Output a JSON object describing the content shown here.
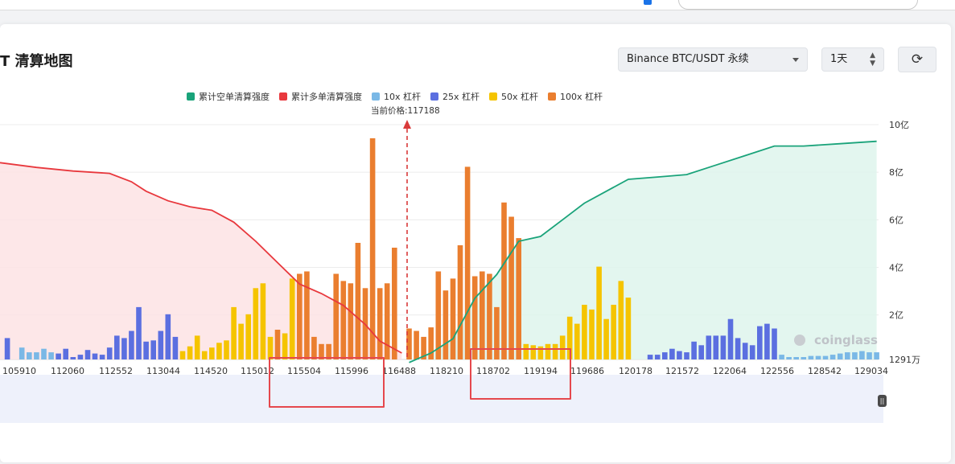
{
  "page": {
    "title": "T 清算地图",
    "exchange_select": "Binance BTC/USDT 永续",
    "period_select": "1天",
    "icons": [
      "refresh-icon",
      "chevron-down-icon",
      "updown-icon"
    ]
  },
  "chart_data": {
    "type": "bar",
    "legend_position": "top",
    "legend": [
      {
        "name": "累计空单清算强度",
        "color": "#1aa37a"
      },
      {
        "name": "累计多单清算强度",
        "color": "#e8383d"
      },
      {
        "name": "10x 杠杆",
        "color": "#7ab8e6"
      },
      {
        "name": "25x 杠杆",
        "color": "#5b6fe0"
      },
      {
        "name": "50x 杠杆",
        "color": "#f5c400"
      },
      {
        "name": "100x 杠杆",
        "color": "#ea7e2f"
      }
    ],
    "current_price_label": "当前价格:117188",
    "current_price": 117188,
    "y_ticks": [
      "10亿",
      "8亿",
      "6亿",
      "4亿",
      "2亿",
      "1291万"
    ],
    "ylim": [
      0.1291,
      10
    ],
    "y_tick_values": [
      10,
      8,
      6,
      4,
      2,
      0.1291
    ],
    "x_ticks": [
      "105910",
      "112060",
      "112552",
      "113044",
      "114520",
      "115012",
      "115504",
      "115996",
      "116488",
      "118210",
      "118702",
      "119194",
      "119686",
      "120178",
      "121572",
      "122064",
      "122556",
      "128542",
      "129034"
    ],
    "bars": [
      {
        "x": 1,
        "h": 0.9,
        "c": "#5b6fe0"
      },
      {
        "x": 3,
        "h": 0.5,
        "c": "#7ab8e6"
      },
      {
        "x": 4,
        "h": 0.3,
        "c": "#7ab8e6"
      },
      {
        "x": 5,
        "h": 0.3,
        "c": "#7ab8e6"
      },
      {
        "x": 6,
        "h": 0.45,
        "c": "#7ab8e6"
      },
      {
        "x": 7,
        "h": 0.3,
        "c": "#7ab8e6"
      },
      {
        "x": 8,
        "h": 0.25,
        "c": "#5b6fe0"
      },
      {
        "x": 9,
        "h": 0.45,
        "c": "#5b6fe0"
      },
      {
        "x": 10,
        "h": 0.1,
        "c": "#5b6fe0"
      },
      {
        "x": 11,
        "h": 0.2,
        "c": "#5b6fe0"
      },
      {
        "x": 12,
        "h": 0.4,
        "c": "#5b6fe0"
      },
      {
        "x": 13,
        "h": 0.25,
        "c": "#5b6fe0"
      },
      {
        "x": 14,
        "h": 0.2,
        "c": "#5b6fe0"
      },
      {
        "x": 15,
        "h": 0.5,
        "c": "#5b6fe0"
      },
      {
        "x": 16,
        "h": 1.0,
        "c": "#5b6fe0"
      },
      {
        "x": 17,
        "h": 0.9,
        "c": "#5b6fe0"
      },
      {
        "x": 18,
        "h": 1.2,
        "c": "#5b6fe0"
      },
      {
        "x": 19,
        "h": 2.2,
        "c": "#5b6fe0"
      },
      {
        "x": 20,
        "h": 0.75,
        "c": "#5b6fe0"
      },
      {
        "x": 21,
        "h": 0.8,
        "c": "#5b6fe0"
      },
      {
        "x": 22,
        "h": 1.2,
        "c": "#5b6fe0"
      },
      {
        "x": 23,
        "h": 1.9,
        "c": "#5b6fe0"
      },
      {
        "x": 24,
        "h": 0.95,
        "c": "#5b6fe0"
      },
      {
        "x": 25,
        "h": 0.35,
        "c": "#f5c400"
      },
      {
        "x": 26,
        "h": 0.55,
        "c": "#f5c400"
      },
      {
        "x": 27,
        "h": 1.0,
        "c": "#f5c400"
      },
      {
        "x": 28,
        "h": 0.35,
        "c": "#f5c400"
      },
      {
        "x": 29,
        "h": 0.5,
        "c": "#f5c400"
      },
      {
        "x": 30,
        "h": 0.7,
        "c": "#f5c400"
      },
      {
        "x": 31,
        "h": 0.8,
        "c": "#f5c400"
      },
      {
        "x": 32,
        "h": 2.2,
        "c": "#f5c400"
      },
      {
        "x": 33,
        "h": 1.5,
        "c": "#f5c400"
      },
      {
        "x": 34,
        "h": 1.9,
        "c": "#f5c400"
      },
      {
        "x": 35,
        "h": 3.0,
        "c": "#f5c400"
      },
      {
        "x": 36,
        "h": 3.2,
        "c": "#f5c400"
      },
      {
        "x": 37,
        "h": 0.95,
        "c": "#f5c400"
      },
      {
        "x": 38,
        "h": 1.25,
        "c": "#ea7e2f"
      },
      {
        "x": 39,
        "h": 1.1,
        "c": "#f5c400"
      },
      {
        "x": 40,
        "h": 3.4,
        "c": "#f5c400"
      },
      {
        "x": 41,
        "h": 3.6,
        "c": "#ea7e2f"
      },
      {
        "x": 42,
        "h": 3.7,
        "c": "#ea7e2f"
      },
      {
        "x": 43,
        "h": 0.95,
        "c": "#ea7e2f"
      },
      {
        "x": 44,
        "h": 0.65,
        "c": "#ea7e2f"
      },
      {
        "x": 45,
        "h": 0.65,
        "c": "#ea7e2f"
      },
      {
        "x": 46,
        "h": 3.6,
        "c": "#ea7e2f"
      },
      {
        "x": 47,
        "h": 3.3,
        "c": "#ea7e2f"
      },
      {
        "x": 48,
        "h": 3.2,
        "c": "#ea7e2f"
      },
      {
        "x": 49,
        "h": 4.9,
        "c": "#ea7e2f"
      },
      {
        "x": 50,
        "h": 3.0,
        "c": "#ea7e2f"
      },
      {
        "x": 51,
        "h": 9.3,
        "c": "#ea7e2f"
      },
      {
        "x": 52,
        "h": 3.0,
        "c": "#ea7e2f"
      },
      {
        "x": 53,
        "h": 3.2,
        "c": "#ea7e2f"
      },
      {
        "x": 54,
        "h": 4.7,
        "c": "#ea7e2f"
      },
      {
        "x": 56,
        "h": 1.3,
        "c": "#ea7e2f"
      },
      {
        "x": 57,
        "h": 1.2,
        "c": "#ea7e2f"
      },
      {
        "x": 58,
        "h": 0.95,
        "c": "#ea7e2f"
      },
      {
        "x": 59,
        "h": 1.35,
        "c": "#ea7e2f"
      },
      {
        "x": 60,
        "h": 3.7,
        "c": "#ea7e2f"
      },
      {
        "x": 61,
        "h": 2.9,
        "c": "#ea7e2f"
      },
      {
        "x": 62,
        "h": 3.4,
        "c": "#ea7e2f"
      },
      {
        "x": 63,
        "h": 4.8,
        "c": "#ea7e2f"
      },
      {
        "x": 64,
        "h": 8.1,
        "c": "#ea7e2f"
      },
      {
        "x": 65,
        "h": 3.5,
        "c": "#ea7e2f"
      },
      {
        "x": 66,
        "h": 3.7,
        "c": "#ea7e2f"
      },
      {
        "x": 67,
        "h": 3.6,
        "c": "#ea7e2f"
      },
      {
        "x": 68,
        "h": 2.2,
        "c": "#ea7e2f"
      },
      {
        "x": 69,
        "h": 6.6,
        "c": "#ea7e2f"
      },
      {
        "x": 70,
        "h": 6.0,
        "c": "#ea7e2f"
      },
      {
        "x": 71,
        "h": 5.1,
        "c": "#ea7e2f"
      },
      {
        "x": 72,
        "h": 0.65,
        "c": "#f5c400"
      },
      {
        "x": 73,
        "h": 0.6,
        "c": "#f5c400"
      },
      {
        "x": 74,
        "h": 0.55,
        "c": "#f5c400"
      },
      {
        "x": 75,
        "h": 0.65,
        "c": "#f5c400"
      },
      {
        "x": 76,
        "h": 0.65,
        "c": "#f5c400"
      },
      {
        "x": 77,
        "h": 1.0,
        "c": "#f5c400"
      },
      {
        "x": 78,
        "h": 1.8,
        "c": "#f5c400"
      },
      {
        "x": 79,
        "h": 1.5,
        "c": "#f5c400"
      },
      {
        "x": 80,
        "h": 2.3,
        "c": "#f5c400"
      },
      {
        "x": 81,
        "h": 2.1,
        "c": "#f5c400"
      },
      {
        "x": 82,
        "h": 3.9,
        "c": "#f5c400"
      },
      {
        "x": 83,
        "h": 1.7,
        "c": "#f5c400"
      },
      {
        "x": 84,
        "h": 2.3,
        "c": "#f5c400"
      },
      {
        "x": 85,
        "h": 3.3,
        "c": "#f5c400"
      },
      {
        "x": 86,
        "h": 2.6,
        "c": "#f5c400"
      },
      {
        "x": 89,
        "h": 0.2,
        "c": "#5b6fe0"
      },
      {
        "x": 90,
        "h": 0.2,
        "c": "#5b6fe0"
      },
      {
        "x": 91,
        "h": 0.3,
        "c": "#5b6fe0"
      },
      {
        "x": 92,
        "h": 0.45,
        "c": "#5b6fe0"
      },
      {
        "x": 93,
        "h": 0.35,
        "c": "#5b6fe0"
      },
      {
        "x": 94,
        "h": 0.3,
        "c": "#5b6fe0"
      },
      {
        "x": 95,
        "h": 0.75,
        "c": "#5b6fe0"
      },
      {
        "x": 96,
        "h": 0.6,
        "c": "#5b6fe0"
      },
      {
        "x": 97,
        "h": 1.0,
        "c": "#5b6fe0"
      },
      {
        "x": 98,
        "h": 1.0,
        "c": "#5b6fe0"
      },
      {
        "x": 99,
        "h": 1.0,
        "c": "#5b6fe0"
      },
      {
        "x": 100,
        "h": 1.7,
        "c": "#5b6fe0"
      },
      {
        "x": 101,
        "h": 0.9,
        "c": "#5b6fe0"
      },
      {
        "x": 102,
        "h": 0.7,
        "c": "#5b6fe0"
      },
      {
        "x": 103,
        "h": 0.6,
        "c": "#5b6fe0"
      },
      {
        "x": 104,
        "h": 1.4,
        "c": "#5b6fe0"
      },
      {
        "x": 105,
        "h": 1.5,
        "c": "#5b6fe0"
      },
      {
        "x": 106,
        "h": 1.3,
        "c": "#5b6fe0"
      },
      {
        "x": 107,
        "h": 0.2,
        "c": "#7ab8e6"
      },
      {
        "x": 108,
        "h": 0.1,
        "c": "#7ab8e6"
      },
      {
        "x": 109,
        "h": 0.1,
        "c": "#7ab8e6"
      },
      {
        "x": 110,
        "h": 0.1,
        "c": "#7ab8e6"
      },
      {
        "x": 111,
        "h": 0.15,
        "c": "#7ab8e6"
      },
      {
        "x": 112,
        "h": 0.15,
        "c": "#7ab8e6"
      },
      {
        "x": 113,
        "h": 0.15,
        "c": "#7ab8e6"
      },
      {
        "x": 114,
        "h": 0.2,
        "c": "#7ab8e6"
      },
      {
        "x": 115,
        "h": 0.25,
        "c": "#7ab8e6"
      },
      {
        "x": 116,
        "h": 0.3,
        "c": "#7ab8e6"
      },
      {
        "x": 117,
        "h": 0.3,
        "c": "#7ab8e6"
      },
      {
        "x": 118,
        "h": 0.35,
        "c": "#7ab8e6"
      },
      {
        "x": 119,
        "h": 0.3,
        "c": "#7ab8e6"
      },
      {
        "x": 120,
        "h": 0.3,
        "c": "#7ab8e6"
      }
    ],
    "long_cumulative": [
      {
        "i": 0,
        "v": 8.4
      },
      {
        "i": 5,
        "v": 8.2
      },
      {
        "i": 10,
        "v": 8.05
      },
      {
        "i": 15,
        "v": 7.95
      },
      {
        "i": 18,
        "v": 7.6
      },
      {
        "i": 20,
        "v": 7.2
      },
      {
        "i": 23,
        "v": 6.8
      },
      {
        "i": 26,
        "v": 6.55
      },
      {
        "i": 29,
        "v": 6.4
      },
      {
        "i": 32,
        "v": 5.9
      },
      {
        "i": 35,
        "v": 5.1
      },
      {
        "i": 38,
        "v": 4.2
      },
      {
        "i": 41,
        "v": 3.3
      },
      {
        "i": 44,
        "v": 2.9
      },
      {
        "i": 47,
        "v": 2.4
      },
      {
        "i": 50,
        "v": 1.6
      },
      {
        "i": 52,
        "v": 0.9
      },
      {
        "i": 55,
        "v": 0.4
      }
    ],
    "short_cumulative": [
      {
        "i": 56,
        "v": 0.0
      },
      {
        "i": 59,
        "v": 0.4
      },
      {
        "i": 62,
        "v": 1.0
      },
      {
        "i": 65,
        "v": 2.7
      },
      {
        "i": 68,
        "v": 3.7
      },
      {
        "i": 71,
        "v": 5.1
      },
      {
        "i": 74,
        "v": 5.3
      },
      {
        "i": 77,
        "v": 6.0
      },
      {
        "i": 80,
        "v": 6.7
      },
      {
        "i": 83,
        "v": 7.2
      },
      {
        "i": 86,
        "v": 7.7
      },
      {
        "i": 90,
        "v": 7.8
      },
      {
        "i": 94,
        "v": 7.9
      },
      {
        "i": 98,
        "v": 8.3
      },
      {
        "i": 102,
        "v": 8.7
      },
      {
        "i": 106,
        "v": 9.1
      },
      {
        "i": 110,
        "v": 9.1
      },
      {
        "i": 115,
        "v": 9.2
      },
      {
        "i": 120,
        "v": 9.3
      }
    ]
  }
}
